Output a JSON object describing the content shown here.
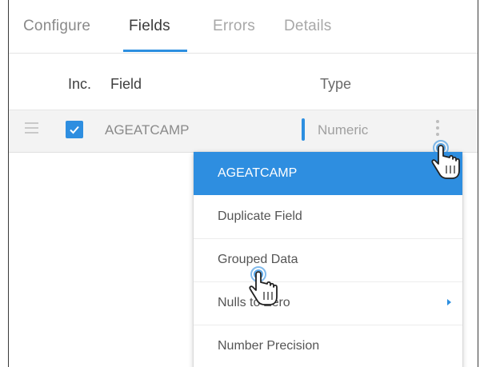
{
  "tabs": [
    {
      "label": "Configure"
    },
    {
      "label": "Fields"
    },
    {
      "label": "Errors"
    },
    {
      "label": "Details"
    }
  ],
  "active_tab": "Fields",
  "columns": {
    "inc": "Inc.",
    "field": "Field",
    "type": "Type"
  },
  "row": {
    "checked": true,
    "field": "AGEATCAMP",
    "type": "Numeric"
  },
  "menu": {
    "items": [
      {
        "label": "AGEATCAMP",
        "active": true
      },
      {
        "label": "Duplicate Field"
      },
      {
        "label": "Grouped Data"
      },
      {
        "label": "Nulls to Zero",
        "has_submenu": true
      },
      {
        "label": "Number Precision"
      }
    ]
  },
  "colors": {
    "accent": "#2e8ee0"
  }
}
